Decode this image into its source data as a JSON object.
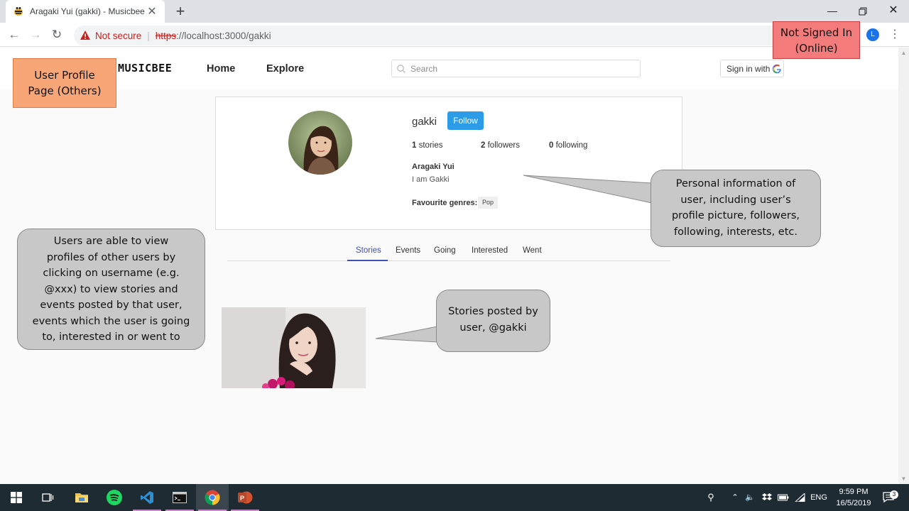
{
  "browser": {
    "tab_title": "Aragaki Yui (gakki) - Musicbee",
    "new_tab": "+",
    "tab_close": "✕",
    "security_label": "Not secure",
    "url_scheme": "https",
    "url_rest": "://localhost:3000/gakki",
    "profile_initial": "L"
  },
  "nav": {
    "logo": "MUSICBEE",
    "home": "Home",
    "explore": "Explore",
    "search_placeholder": "Search",
    "signin": "Sign in with"
  },
  "profile": {
    "username": "gakki",
    "follow": "Follow",
    "stories_count": "1",
    "stories_label": "stories",
    "followers_count": "2",
    "followers_label": "followers",
    "following_count": "0",
    "following_label": "following",
    "full_name": "Aragaki Yui",
    "bio": "I am Gakki",
    "fav_genres_label": "Favourite genres:",
    "genres": [
      "Pop"
    ]
  },
  "tabs": [
    "Stories",
    "Events",
    "Going",
    "Interested",
    "Went"
  ],
  "active_tab": "Stories",
  "annotations": {
    "page_label_line1": "User Profile",
    "page_label_line2": "Page (Others)",
    "status_line1": "Not Signed In",
    "status_line2": "(Online)",
    "personal_info": [
      "Personal information of",
      "user, including user’s",
      "profile picture, followers,",
      "following, interests, etc."
    ],
    "users_view": [
      "Users are able to view",
      "profiles of other users by",
      "clicking on username (e.g.",
      "@xxx) to view stories and",
      "events posted by that user,",
      "events which the user is going",
      "to, interested in or went to"
    ],
    "stories_posted": [
      "Stories posted by",
      "user, @gakki"
    ]
  },
  "taskbar": {
    "language": "ENG",
    "time": "9:59 PM",
    "date": "16/5/2019",
    "notifications": "3"
  },
  "colors": {
    "accent": "#3f51b5",
    "follow_button": "#2d9ce8",
    "not_secure": "#c5221f",
    "orange_note": "#f8a677",
    "red_note": "#f47b7b",
    "callout": "#c8c8c8",
    "taskbar": "#1f2b33"
  }
}
